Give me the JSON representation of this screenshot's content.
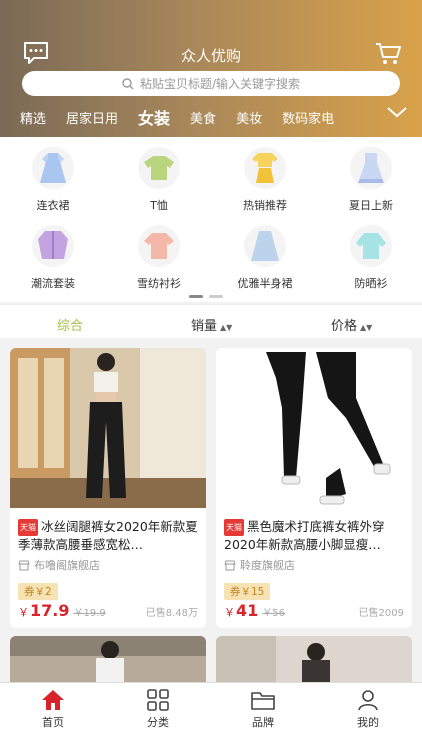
{
  "header": {
    "title": "众人优购",
    "search_placeholder": "粘贴宝贝标题/输入关键字搜索"
  },
  "categories": [
    "精选",
    "居家日用",
    "女装",
    "美食",
    "美妆",
    "数码家电"
  ],
  "subcategories": [
    {
      "label": "连衣裙",
      "icon": "dress-icon"
    },
    {
      "label": "T恤",
      "icon": "tshirt-icon"
    },
    {
      "label": "热销推荐",
      "icon": "hot-outfit-icon"
    },
    {
      "label": "夏日上新",
      "icon": "summer-dress-icon"
    },
    {
      "label": "潮流套装",
      "icon": "suit-icon"
    },
    {
      "label": "雪纺衬衫",
      "icon": "chiffon-shirt-icon"
    },
    {
      "label": "优雅半身裙",
      "icon": "skirt-icon"
    },
    {
      "label": "防晒衫",
      "icon": "sun-shirt-icon"
    }
  ],
  "sort": {
    "comprehensive": "综合",
    "sales": "销量",
    "price": "价格"
  },
  "products": [
    {
      "badge": "天猫",
      "title": "冰丝阔腿裤女2020年新款夏季薄款高腰垂感宽松…",
      "shop": "布噜阁旗舰店",
      "coupon": "券￥2",
      "currency": "￥",
      "price": "17.9",
      "original_price": "￥19.9",
      "sold": "已售8.48万"
    },
    {
      "badge": "天猫",
      "title": "黑色魔术打底裤女裤外穿2020年新款高腰小脚显瘦…",
      "shop": "聆度旗舰店",
      "coupon": "券￥15",
      "currency": "￥",
      "price": "41",
      "original_price": "￥56",
      "sold": "已售2009"
    }
  ],
  "tabbar": [
    {
      "label": "首页",
      "icon": "home-icon"
    },
    {
      "label": "分类",
      "icon": "category-grid-icon"
    },
    {
      "label": "品牌",
      "icon": "folder-icon"
    },
    {
      "label": "我的",
      "icon": "user-icon"
    }
  ],
  "colors": {
    "accent": "#d8232a",
    "active_tab": "#a5c24a",
    "header_start": "#7a6a56",
    "header_end": "#d9a24a"
  }
}
